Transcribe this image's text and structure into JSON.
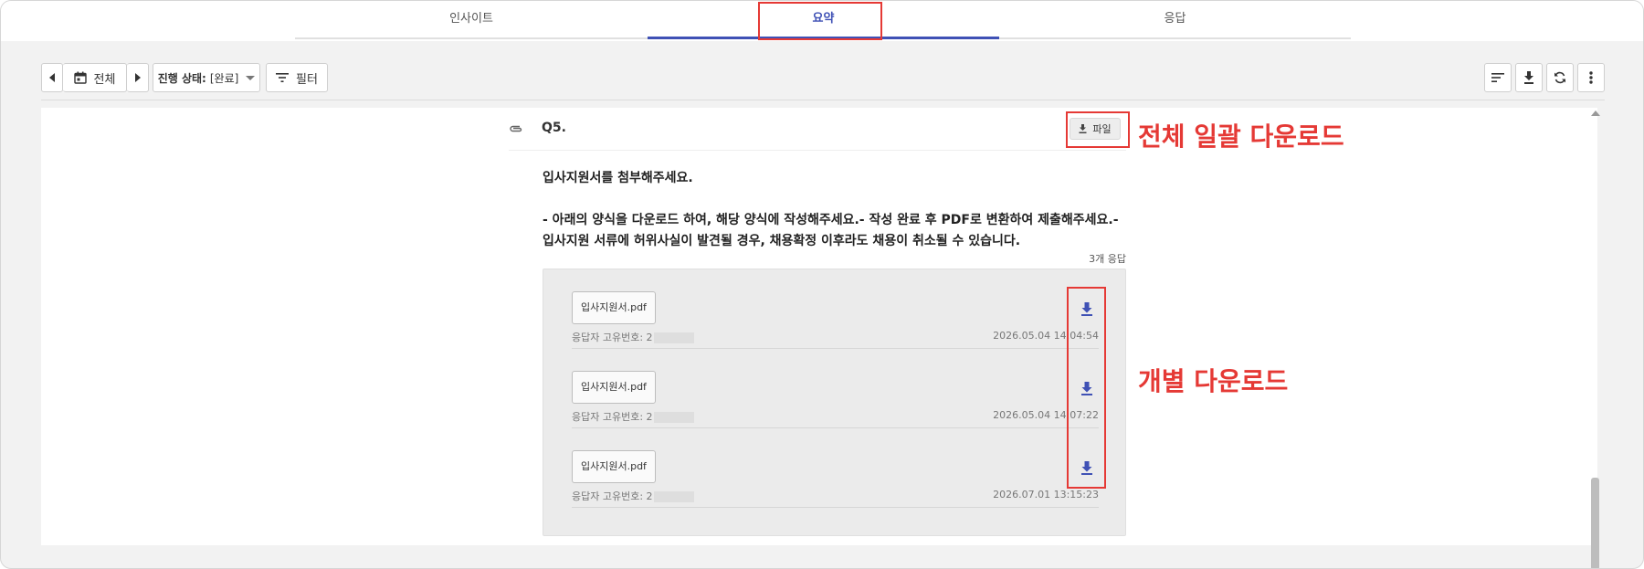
{
  "tabs": [
    {
      "label": "인사이트"
    },
    {
      "label": "요약"
    },
    {
      "label": "응답"
    }
  ],
  "toolbar": {
    "date_label": "전체",
    "status_prefix": "진행 상태:",
    "status_value": "[완료]",
    "filter_label": "필터"
  },
  "question": {
    "number": "Q5.",
    "download_all_label": "파일",
    "title": "입사지원서를 첨부해주세요.",
    "description": "- 아래의 양식을 다운로드 하여, 해당 양식에 작성해주세요.- 작성 완료 후 PDF로 변환하여 제출해주세요.- 입사지원 서류에 허위사실이 발견될 경우, 채용확정 이후라도 채용이 취소될 수 있습니다.",
    "response_count": "3개 응답"
  },
  "responses": [
    {
      "file": "입사지원서.pdf",
      "respondent_label": "응답자 고유번호:",
      "respondent_id": "2",
      "time": "2026.05.04 14:04:54"
    },
    {
      "file": "입사지원서.pdf",
      "respondent_label": "응답자 고유번호:",
      "respondent_id": "2",
      "time": "2026.05.04 14:07:22"
    },
    {
      "file": "입사지원서.pdf",
      "respondent_label": "응답자 고유번호:",
      "respondent_id": "2",
      "time": "2026.07.01 13:15:23"
    }
  ],
  "annotations": {
    "download_all": "전체 일괄 다운로드",
    "download_each": "개별 다운로드"
  },
  "colors": {
    "accent": "#3f51b5",
    "annotation_red": "#e53935"
  }
}
